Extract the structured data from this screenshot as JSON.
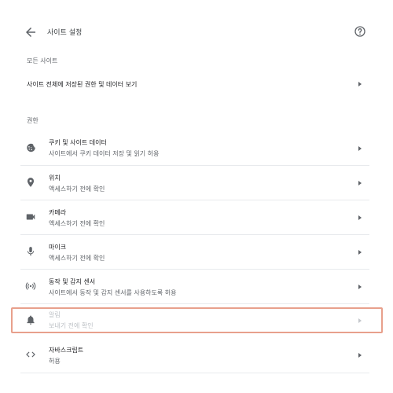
{
  "header": {
    "title": "사이트 설정"
  },
  "all_sites": {
    "section_label": "모든 사이트",
    "row_label": "사이트 전체에 저장된 권한 및 데이터 보기"
  },
  "permissions": {
    "section_label": "권한",
    "items": [
      {
        "title": "쿠키 및 사이트 데이터",
        "subtitle": "사이트에서 쿠키 데이터 저장 및 읽기 허용",
        "icon": "cookie-icon"
      },
      {
        "title": "위치",
        "subtitle": "액세스하기 전에 확인",
        "icon": "location-pin-icon"
      },
      {
        "title": "카메라",
        "subtitle": "액세스하기 전에 확인",
        "icon": "camera-icon"
      },
      {
        "title": "마이크",
        "subtitle": "액세스하기 전에 확인",
        "icon": "microphone-icon"
      },
      {
        "title": "동작 및 감지 센서",
        "subtitle": "사이트에서 동작 및 감지 센서를 사용하도록 허용",
        "icon": "sensors-icon"
      },
      {
        "title": "알림",
        "subtitle": "보내기 전에 확인",
        "icon": "bell-icon",
        "disabled": true
      },
      {
        "title": "자바스크립트",
        "subtitle": "허용",
        "icon": "code-icon"
      }
    ]
  },
  "colors": {
    "highlight": "#e8a08c",
    "divider": "#e8eaed",
    "icon": "#5f6368"
  }
}
